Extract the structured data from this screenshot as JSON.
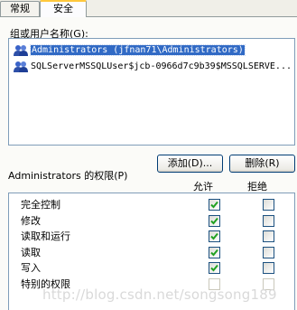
{
  "tabs": [
    {
      "label": "常规",
      "active": false
    },
    {
      "label": "安全",
      "active": true
    }
  ],
  "users": {
    "label": "组或用户名称(G):",
    "items": [
      {
        "name": "Administrators (jfnan71\\Administrators)",
        "icon": "user-group-icon",
        "selected": true
      },
      {
        "name": "SQLServerMSSQLUser$jcb-0966d7c9b39$MSSQLSERVE...",
        "icon": "user-group-icon",
        "selected": false
      }
    ]
  },
  "buttons": {
    "add": "添加(D)...",
    "remove": "删除(R)"
  },
  "permissions": {
    "label": "Administrators 的权限(P)",
    "col_allow": "允许",
    "col_deny": "拒绝",
    "rows": [
      {
        "name": "完全控制",
        "allow": true,
        "deny": false,
        "disabled": false
      },
      {
        "name": "修改",
        "allow": true,
        "deny": false,
        "disabled": false
      },
      {
        "name": "读取和运行",
        "allow": true,
        "deny": false,
        "disabled": false
      },
      {
        "name": "读取",
        "allow": true,
        "deny": false,
        "disabled": false
      },
      {
        "name": "写入",
        "allow": true,
        "deny": false,
        "disabled": false
      },
      {
        "name": "特别的权限",
        "allow": false,
        "deny": false,
        "disabled": true
      }
    ]
  },
  "watermark": "http://blog.csdn.net/songsong189",
  "colors": {
    "selection": "#316ac5",
    "check": "#21a121",
    "border": "#7f9db9"
  }
}
